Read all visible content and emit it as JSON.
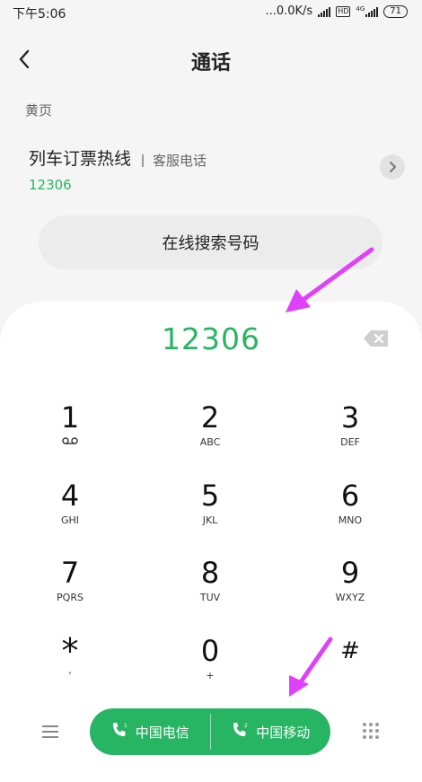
{
  "status_bar": {
    "time": "下午5:06",
    "network_speed": "...0.0K/s",
    "hd_label": "HD",
    "net_type": "4G",
    "battery": "71"
  },
  "header": {
    "title": "通话",
    "back_icon": "chevron-left-icon"
  },
  "yellow_pages": {
    "section_label": "黄页",
    "name": "列车订票热线",
    "category": "客服电话",
    "number": "12306"
  },
  "search_online_label": "在线搜索号码",
  "dialer": {
    "dialed_number": "12306",
    "keys": [
      {
        "digit": "1",
        "sub": ""
      },
      {
        "digit": "2",
        "sub": "ABC"
      },
      {
        "digit": "3",
        "sub": "DEF"
      },
      {
        "digit": "4",
        "sub": "GHI"
      },
      {
        "digit": "5",
        "sub": "JKL"
      },
      {
        "digit": "6",
        "sub": "MNO"
      },
      {
        "digit": "7",
        "sub": "PQRS"
      },
      {
        "digit": "8",
        "sub": "TUV"
      },
      {
        "digit": "9",
        "sub": "WXYZ"
      },
      {
        "digit": "*",
        "sub": ","
      },
      {
        "digit": "0",
        "sub": "+"
      },
      {
        "digit": "#",
        "sub": ""
      }
    ]
  },
  "call_buttons": [
    {
      "label": "中国电信",
      "sim": "1"
    },
    {
      "label": "中国移动",
      "sim": "2"
    }
  ],
  "colors": {
    "accent": "#27b463",
    "annotation": "#e040fb"
  }
}
